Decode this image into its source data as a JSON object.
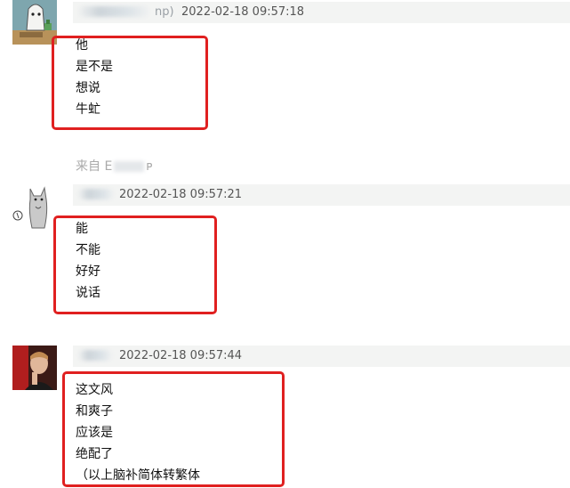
{
  "messages": [
    {
      "sender_visible": "np)",
      "timestamp": "2022-02-18 09:57:18",
      "lines": [
        "他",
        "是不是",
        "想说",
        "牛虻"
      ],
      "avatar_icon": "ghost-cartoon-avatar"
    },
    {
      "sender_visible": "",
      "timestamp": "2022-02-18 09:57:21",
      "lines": [
        "能",
        "不能",
        "好好",
        "说话"
      ],
      "avatar_icon": "sketched-cat-avatar"
    },
    {
      "sender_visible": "",
      "timestamp": "2022-02-18 09:57:44",
      "lines": [
        "这文风",
        "和爽子",
        "应该是",
        "绝配了",
        "（以上脑补简体转繁体"
      ],
      "avatar_icon": "man-portrait-avatar"
    }
  ],
  "source": {
    "prefix": "来自",
    "fragment_1": "E",
    "fragment_2": "ᴘ"
  },
  "colors": {
    "highlight_border": "#e02020",
    "header_bar": "#f3f4f3",
    "timestamp_text": "#555555",
    "message_text": "#111111",
    "source_text": "#aaaaaa"
  }
}
